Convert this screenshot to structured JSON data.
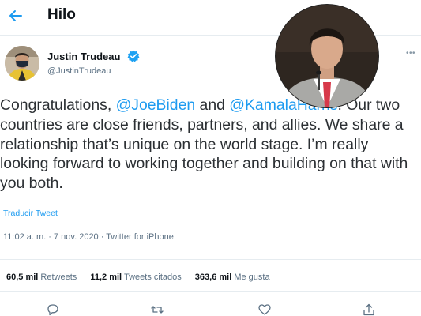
{
  "header": {
    "title": "Hilo"
  },
  "author": {
    "name": "Justin Trudeau",
    "handle": "@JustinTrudeau"
  },
  "tweet": {
    "part1": "Congratulations, ",
    "mention1": "@JoeBiden",
    "part2": " and ",
    "mention2": "@KamalaHarris",
    "part3": ". Our two countries are close friends, partners, and allies. We share a relationship that’s unique on the world stage. I’m really looking forward to working together and building on that with you both."
  },
  "translate_label": "Traducir Tweet",
  "meta": {
    "time": "11:02 a. m.",
    "date": "7 nov. 2020",
    "source": "Twitter for iPhone",
    "separator": " · "
  },
  "stats": {
    "retweets_count": "60,5 mil",
    "retweets_label": "Retweets",
    "quotes_count": "11,2 mil",
    "quotes_label": "Tweets citados",
    "likes_count": "363,6 mil",
    "likes_label": "Me gusta"
  },
  "colors": {
    "link": "#1d9bf0",
    "secondary_text": "#5b7083",
    "verified": "#1da1f2"
  },
  "icons": [
    "back-arrow-icon",
    "verified-badge-icon",
    "more-options-icon",
    "reply-icon",
    "retweet-icon",
    "like-icon",
    "share-icon"
  ]
}
